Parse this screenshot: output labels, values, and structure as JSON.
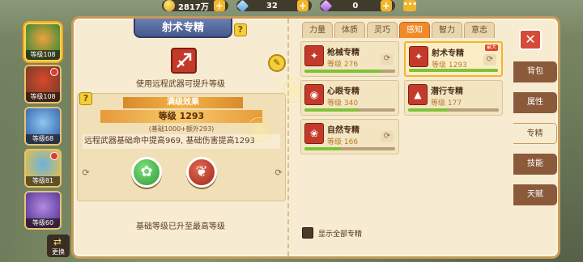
{
  "currency": {
    "gold": "2817万",
    "diamond": "32",
    "purple": "0"
  },
  "characters": [
    {
      "level": "等级108",
      "color1": "#f0a23a",
      "color2": "#3a8a3a",
      "active": true,
      "mark": false
    },
    {
      "level": "等级108",
      "color1": "#d84a2a",
      "color2": "#7a3a2a",
      "active": false,
      "mark": true
    },
    {
      "level": "等级68",
      "color1": "#8ec6f0",
      "color2": "#3a6ab2",
      "active": false,
      "mark": false
    },
    {
      "level": "等级81",
      "color1": "#6ab2e2",
      "color2": "#e0c04a",
      "active": false,
      "mark": true
    },
    {
      "level": "等级60",
      "color1": "#b28ae0",
      "color2": "#5a3a9a",
      "active": false,
      "mark": false
    }
  ],
  "swap_label": "更换",
  "left": {
    "title": "射术专精",
    "description": "使用远程武器可提升等级",
    "max_effect": "满级效果",
    "level": "等级 1293",
    "level_detail": "(基础1000+额外293)",
    "effect_text": "远程武器基础命中提高969, 基础伤害提高1293",
    "base_max": "基础等级已升至最高等级",
    "help": "?"
  },
  "tabs": [
    "力量",
    "体质",
    "灵巧",
    "感知",
    "智力",
    "意志"
  ],
  "active_tab": 3,
  "specs": [
    {
      "name": "枪械专精",
      "level": "等级 276",
      "progress": 0.85,
      "active": false,
      "glyph": "✦",
      "swap": true
    },
    {
      "name": "射术专精",
      "level": "等级 1293",
      "progress": 1.0,
      "active": true,
      "glyph": "✦",
      "swap": true,
      "max_tag": "最大"
    },
    {
      "name": "心眼专精",
      "level": "等级 340",
      "progress": 0.6,
      "active": false,
      "glyph": "◉",
      "swap": false
    },
    {
      "name": "潜行专精",
      "level": "等级 177",
      "progress": 0.45,
      "active": false,
      "glyph": "▲",
      "swap": false
    },
    {
      "name": "自然专精",
      "level": "等级 166",
      "progress": 0.4,
      "active": false,
      "glyph": "❀",
      "swap": true
    }
  ],
  "show_all": "显示全部专精",
  "side_tabs": [
    "背包",
    "属性",
    "专精",
    "技能",
    "天赋"
  ],
  "active_side_tab": 2,
  "close": "✕",
  "colors": {
    "tab_active": "#f08a2a",
    "panel": "#f7ecd2",
    "progress": "#7fc23a"
  }
}
